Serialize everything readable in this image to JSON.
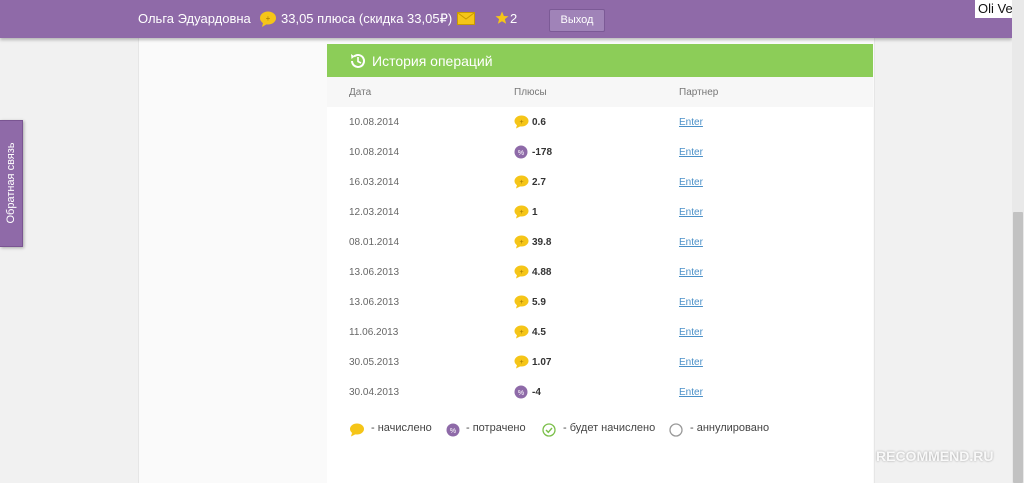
{
  "header": {
    "user_name": "Ольга Эдуардовна",
    "points_text": "33,05 плюса (скидка 33,05₽)",
    "stars": "2",
    "logout_label": "Выход",
    "corner_text": "Oli Ver"
  },
  "feedback_label": "Обратная связь",
  "history": {
    "title": "История операций",
    "columns": {
      "date": "Дата",
      "pluses": "Плюсы",
      "partner": "Партнер"
    },
    "rows": [
      {
        "date": "10.08.2014",
        "type": "accrued",
        "amount": "0.6",
        "partner": "Enter"
      },
      {
        "date": "10.08.2014",
        "type": "spent",
        "amount": "-178",
        "partner": "Enter"
      },
      {
        "date": "16.03.2014",
        "type": "accrued",
        "amount": "2.7",
        "partner": "Enter"
      },
      {
        "date": "12.03.2014",
        "type": "accrued",
        "amount": "1",
        "partner": "Enter"
      },
      {
        "date": "08.01.2014",
        "type": "accrued",
        "amount": "39.8",
        "partner": "Enter"
      },
      {
        "date": "13.06.2013",
        "type": "accrued",
        "amount": "4.88",
        "partner": "Enter"
      },
      {
        "date": "13.06.2013",
        "type": "accrued",
        "amount": "5.9",
        "partner": "Enter"
      },
      {
        "date": "11.06.2013",
        "type": "accrued",
        "amount": "4.5",
        "partner": "Enter"
      },
      {
        "date": "30.05.2013",
        "type": "accrued",
        "amount": "1.07",
        "partner": "Enter"
      },
      {
        "date": "30.04.2013",
        "type": "spent",
        "amount": "-4",
        "partner": "Enter"
      }
    ],
    "legend": {
      "accrued": "- начислено",
      "spent": "- потрачено",
      "pending": "- будет начислено",
      "cancelled": "- аннулировано"
    }
  },
  "watermark": "RECOMMEND.RU",
  "colors": {
    "header_bg": "#8f6aa8",
    "panel_header_bg": "#8ccd58",
    "coin": "#f5c518",
    "spent": "#8e6aa8",
    "pending": "#7bbf4a",
    "link": "#4a90c8"
  }
}
